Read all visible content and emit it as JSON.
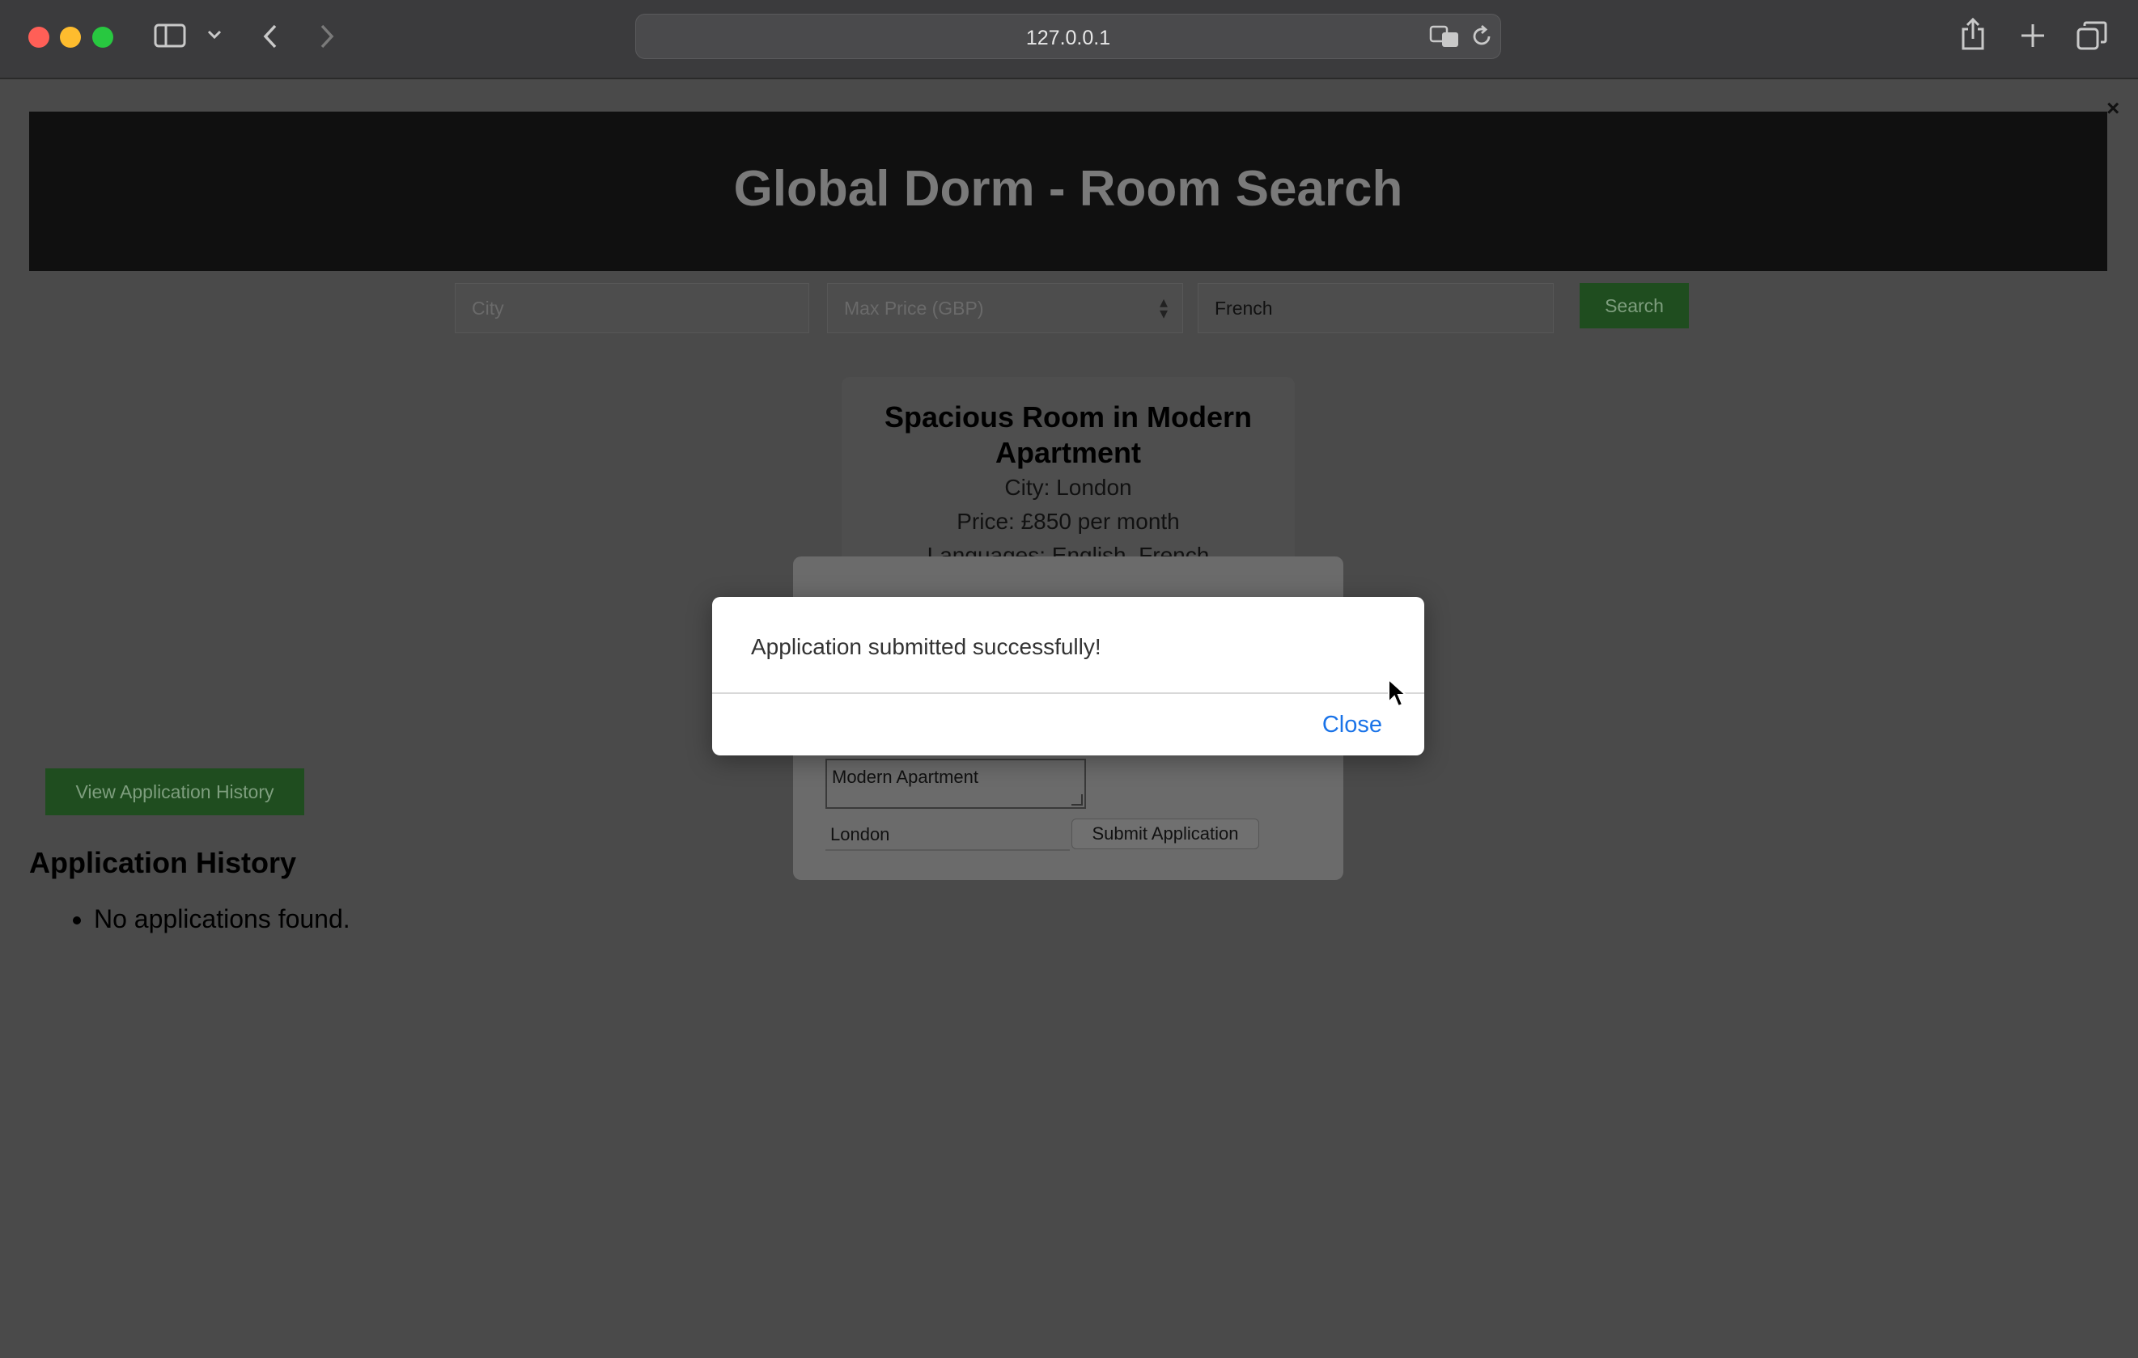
{
  "browser": {
    "url": "127.0.0.1",
    "icons": [
      "sidebar-icon",
      "chevron-down-icon",
      "back-icon",
      "forward-icon",
      "translate-icon",
      "reload-icon",
      "share-icon",
      "new-tab-icon",
      "tabs-overview-icon"
    ]
  },
  "page": {
    "close_glyph": "×",
    "header": {
      "title": "Global Dorm - Room Search"
    },
    "search": {
      "city_placeholder": "City",
      "price_placeholder": "Max Price (GBP)",
      "language_value": "French",
      "search_label": "Search"
    },
    "listing": {
      "title": "Spacious Room in Modern Apartment",
      "city": "City: London",
      "price": "Price: £850 per month",
      "languages": "Languages: English, French"
    },
    "application_form": {
      "description_value": "Modern Apartment",
      "city_value": "London",
      "submit_label": "Submit Application"
    },
    "history": {
      "button_label": "View Application History",
      "title": "Application History",
      "items": [
        "No applications found."
      ]
    }
  },
  "alert": {
    "message": "Application submitted successfully!",
    "close_label": "Close"
  },
  "colors": {
    "toolbar_bg": "#3b3b3d",
    "page_dim_bg": "#4a4a4a",
    "accent_green": "#1f4d1f",
    "link_blue": "#1a73e8"
  }
}
